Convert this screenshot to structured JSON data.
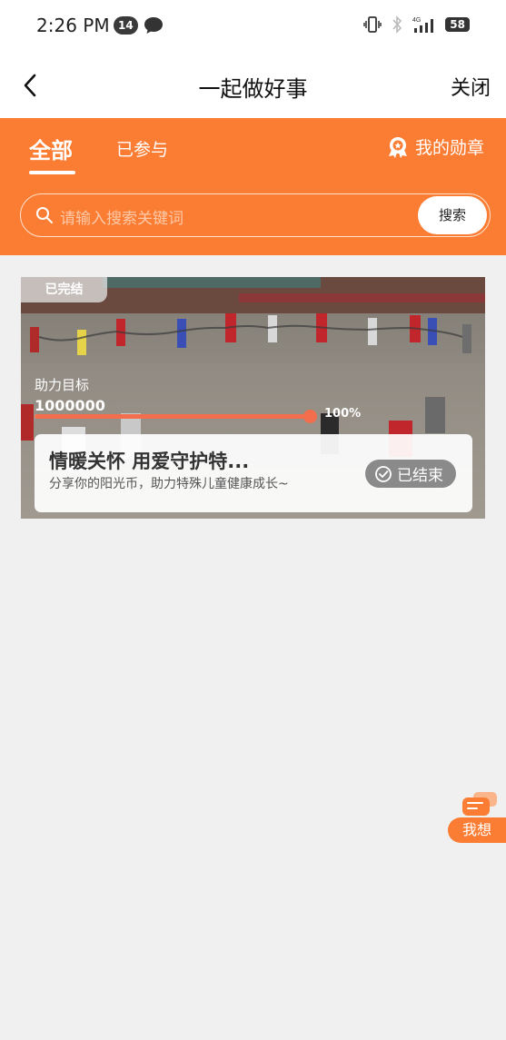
{
  "status_bar": {
    "time": "2:26 PM",
    "notification_count": "14",
    "network": "4G",
    "battery": "58"
  },
  "nav": {
    "title": "一起做好事",
    "close_label": "关闭"
  },
  "tabs": [
    {
      "label": "全部",
      "active": true
    },
    {
      "label": "已参与",
      "active": false
    }
  ],
  "medal_label": "我的勋章",
  "search": {
    "placeholder": "请输入搜索关键词",
    "button_label": "搜索"
  },
  "card": {
    "status_tag": "已完结",
    "goal_label": "助力目标",
    "goal_value": "1000000",
    "progress_percent": 100,
    "progress_text": "100%",
    "title": "情暖关怀 用爱守护特...",
    "description": "分享你的阳光币，助力特殊儿童健康成长~",
    "ended_label": "已结束"
  },
  "float_button_label": "我想",
  "colors": {
    "accent": "#fb7d33",
    "progress": "#f26e4c",
    "background": "#f0f0f0"
  }
}
